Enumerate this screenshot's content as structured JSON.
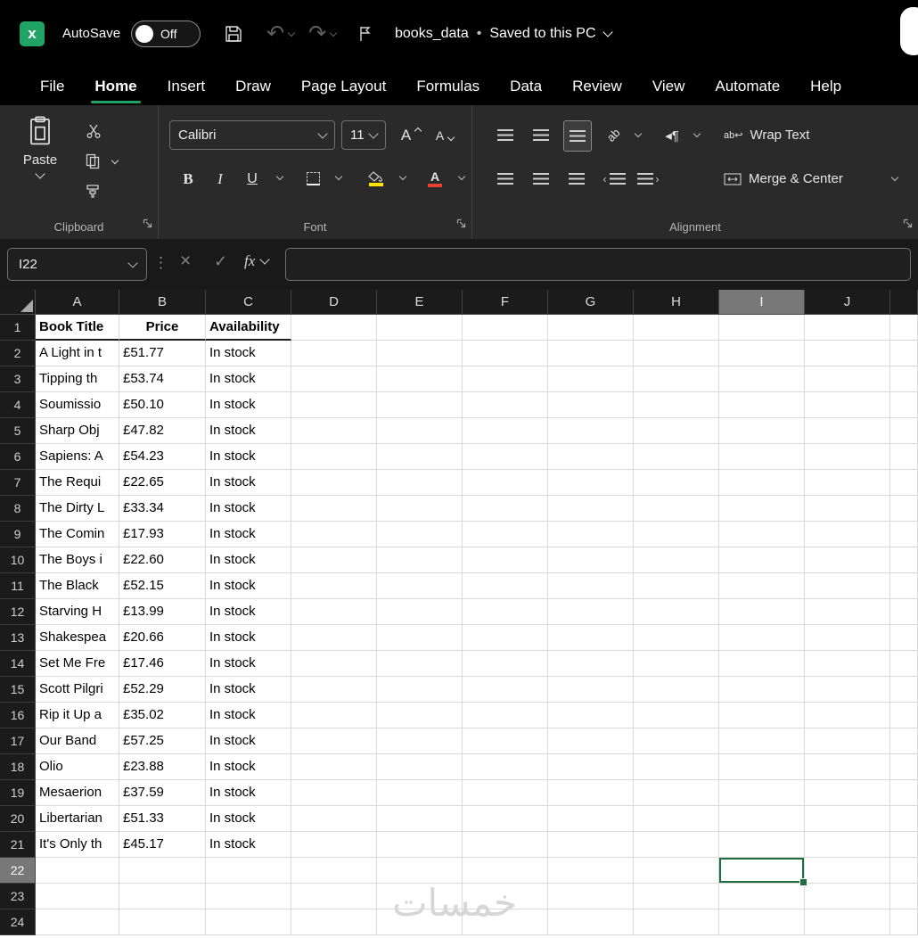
{
  "titlebar": {
    "autosave_label": "AutoSave",
    "autosave_state": "Off",
    "doc_title": "books_data",
    "separator": "•",
    "doc_status": "Saved to this PC"
  },
  "menu": {
    "items": [
      "File",
      "Home",
      "Insert",
      "Draw",
      "Page Layout",
      "Formulas",
      "Data",
      "Review",
      "View",
      "Automate",
      "Help"
    ],
    "active": "Home"
  },
  "ribbon": {
    "paste_label": "Paste",
    "font_name": "Calibri",
    "font_size": "11",
    "font_buttons": {
      "bold": "B",
      "italic": "I",
      "underline": "U",
      "grow": "A",
      "shrink": "A"
    },
    "orientation_glyph": "ab",
    "wrap_text_label": "Wrap Text",
    "merge_center_label": "Merge & Center",
    "groups": {
      "clipboard": "Clipboard",
      "font": "Font",
      "alignment": "Alignment"
    }
  },
  "formula_bar": {
    "name_box": "I22",
    "fx_label": "fx",
    "formula_value": ""
  },
  "grid": {
    "column_letters": [
      "A",
      "B",
      "C",
      "D",
      "E",
      "F",
      "G",
      "H",
      "I",
      "J"
    ],
    "visible_rows": 24,
    "selected_cell": {
      "column": "I",
      "row": 22
    },
    "header_row": {
      "row": 1,
      "cells": {
        "A": "Book Title",
        "B": "Price",
        "C": "Availability"
      }
    },
    "records": [
      {
        "row": 2,
        "book_title": "A Light in t",
        "price": "£51.77",
        "availability": "In stock"
      },
      {
        "row": 3,
        "book_title": "Tipping th",
        "price": "£53.74",
        "availability": "In stock"
      },
      {
        "row": 4,
        "book_title": "Soumissio",
        "price": "£50.10",
        "availability": "In stock"
      },
      {
        "row": 5,
        "book_title": "Sharp Obj",
        "price": "£47.82",
        "availability": "In stock"
      },
      {
        "row": 6,
        "book_title": "Sapiens: A",
        "price": "£54.23",
        "availability": "In stock"
      },
      {
        "row": 7,
        "book_title": "The Requi",
        "price": "£22.65",
        "availability": "In stock"
      },
      {
        "row": 8,
        "book_title": "The Dirty L",
        "price": "£33.34",
        "availability": "In stock"
      },
      {
        "row": 9,
        "book_title": "The Comin",
        "price": "£17.93",
        "availability": "In stock"
      },
      {
        "row": 10,
        "book_title": "The Boys i",
        "price": "£22.60",
        "availability": "In stock"
      },
      {
        "row": 11,
        "book_title": "The Black",
        "price": "£52.15",
        "availability": "In stock"
      },
      {
        "row": 12,
        "book_title": "Starving H",
        "price": "£13.99",
        "availability": "In stock"
      },
      {
        "row": 13,
        "book_title": "Shakespea",
        "price": "£20.66",
        "availability": "In stock"
      },
      {
        "row": 14,
        "book_title": "Set Me Fre",
        "price": "£17.46",
        "availability": "In stock"
      },
      {
        "row": 15,
        "book_title": "Scott Pilgri",
        "price": "£52.29",
        "availability": "In stock"
      },
      {
        "row": 16,
        "book_title": "Rip it Up a",
        "price": "£35.02",
        "availability": "In stock"
      },
      {
        "row": 17,
        "book_title": "Our Band",
        "price": "£57.25",
        "availability": "In stock"
      },
      {
        "row": 18,
        "book_title": "Olio",
        "price": "£23.88",
        "availability": "In stock"
      },
      {
        "row": 19,
        "book_title": "Mesaerion",
        "price": "£37.59",
        "availability": "In stock"
      },
      {
        "row": 20,
        "book_title": "Libertarian",
        "price": "£51.33",
        "availability": "In stock"
      },
      {
        "row": 21,
        "book_title": "It's Only th",
        "price": "£45.17",
        "availability": "In stock"
      }
    ]
  },
  "watermark": {
    "text": "خمسات"
  },
  "colors": {
    "accent_green": "#21a366",
    "selection_green": "#1e6e41",
    "fill_yellow": "#ffe500",
    "font_red": "#e8412c",
    "header_selected": "#787878",
    "watermark_gray": "#d6d6d6"
  }
}
